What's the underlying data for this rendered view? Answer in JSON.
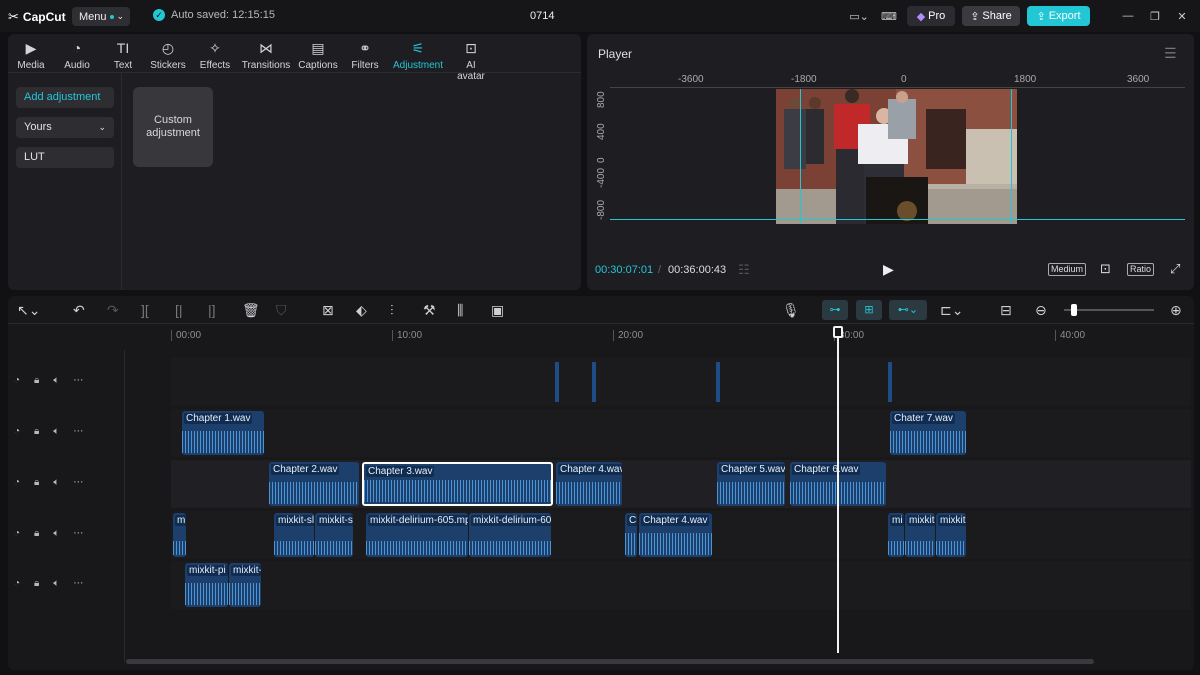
{
  "titlebar": {
    "logo_text": "CapCut",
    "menu_label": "Menu",
    "autosave_text": "Auto saved: 12:15:15",
    "project_name": "0714",
    "pro_label": "Pro",
    "share_label": "Share",
    "export_label": "Export"
  },
  "toolbar": {
    "tools": [
      {
        "label": "Media",
        "icon": "media-icon"
      },
      {
        "label": "Audio",
        "icon": "audio-icon"
      },
      {
        "label": "Text",
        "icon": "text-icon"
      },
      {
        "label": "Stickers",
        "icon": "stickers-icon"
      },
      {
        "label": "Effects",
        "icon": "effects-icon"
      },
      {
        "label": "Transitions",
        "icon": "transitions-icon"
      },
      {
        "label": "Captions",
        "icon": "captions-icon"
      },
      {
        "label": "Filters",
        "icon": "filters-icon"
      },
      {
        "label": "Adjustment",
        "icon": "adjustment-icon"
      },
      {
        "label": "AI avatar",
        "icon": "ai-avatar-icon"
      }
    ],
    "active": "Adjustment"
  },
  "adjustment_panel": {
    "add_label": "Add adjustment",
    "yours_label": "Yours",
    "lut_label": "LUT",
    "custom_label": "Custom adjustment"
  },
  "player": {
    "title": "Player",
    "ruler_x": [
      "-3600",
      "-1800",
      "0",
      "1800",
      "3600"
    ],
    "ruler_y": [
      "800",
      "400",
      "0",
      "-400",
      "-800"
    ],
    "current_time": "00:30:07:01",
    "total_time": "00:36:00:43",
    "quality_label": "Medium",
    "ratio_label": "Ratio"
  },
  "timeline": {
    "ticks": [
      "00:00",
      "10:00",
      "20:00",
      "30:00",
      "40:00"
    ],
    "tracks": [
      {
        "clips": []
      },
      {
        "clips": [
          "Chapter 1.wav",
          "Chater 7.wav"
        ]
      },
      {
        "clips": [
          "Chapter 2.wav",
          "Chapter 3.wav",
          "Chapter 4.wav",
          "Chapter 5.wav",
          "Chapter 6.wav"
        ]
      },
      {
        "clips": [
          "mi",
          "mixkit-sl",
          "mixkit-sl",
          "mixkit-delirium-605.mp",
          "mixkit-delirium-60",
          "Ch",
          "Chapter 4.wav",
          "mi",
          "mixkit",
          "mixkit"
        ]
      },
      {
        "clips": [
          "mixkit-pi",
          "mixkit-"
        ]
      }
    ]
  },
  "colors": {
    "accent": "#22c7d6",
    "clip": "#1c3f6b",
    "wave": "#4a95d8"
  }
}
